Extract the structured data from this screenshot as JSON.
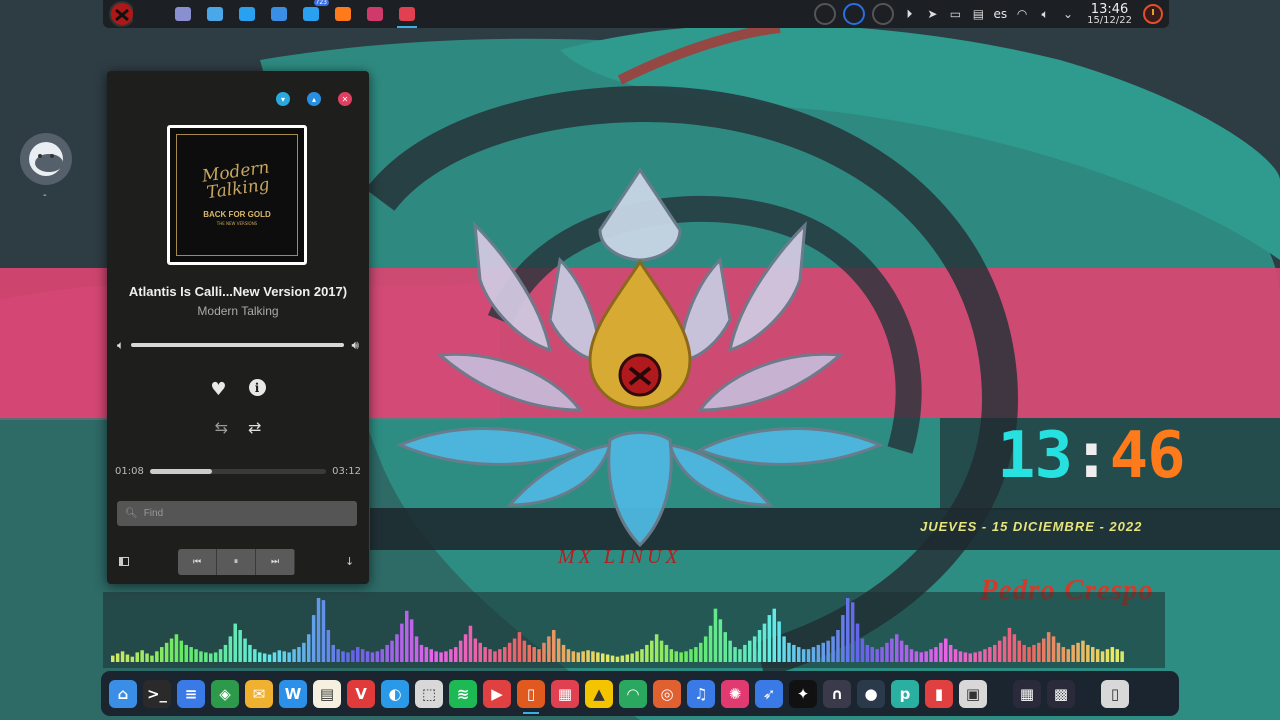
{
  "top_panel": {
    "apps": [
      {
        "icon": "desktop-pager-icon",
        "color": "#8a8fcf"
      },
      {
        "icon": "settings-sliders-icon",
        "color": "#4aa8e8"
      },
      {
        "icon": "browser-globe-icon",
        "color": "#2aa0f0"
      },
      {
        "icon": "file-manager-icon",
        "color": "#3a8ee6"
      },
      {
        "icon": "messaging-app-icon",
        "color": "#2aa0f0",
        "badge": "723"
      },
      {
        "icon": "firefox-icon",
        "color": "#ff7a1a"
      },
      {
        "icon": "screen-capture-icon",
        "color": "#d03a6a"
      },
      {
        "icon": "music-player-icon",
        "color": "#e04050",
        "active": true
      }
    ],
    "tray": {
      "keyboard_layout": "es",
      "time": "13:46",
      "date": "15/12/22"
    }
  },
  "desktop": {
    "face_widget_label": "-"
  },
  "player": {
    "album_title": "Modern Talking",
    "album_subtitle": "BACK FOR GOLD",
    "album_tagline": "THE NEW VERSIONS",
    "song_title": "Atlantis Is Calli...New Version 2017)",
    "artist": "Modern Talking",
    "volume": 1.0,
    "elapsed": "01:08",
    "duration": "03:12",
    "progress": 0.354,
    "find_placeholder": "Find"
  },
  "clock_widget": {
    "hour": "13",
    "colon": ":",
    "minute": "46",
    "date_text": "JUEVES - 15 DICIEMBRE - 2022",
    "author": "Pedro Crespo"
  },
  "wallpaper": {
    "logo_text": "MX LINUX"
  },
  "dock": {
    "items": [
      {
        "icon": "home-folder-icon",
        "color": "#3a8ee6",
        "glyph": "⌂"
      },
      {
        "icon": "terminal-icon",
        "color": "#2a2a2a",
        "glyph": ">_"
      },
      {
        "icon": "document-icon",
        "color": "#3a7ae6",
        "glyph": "≡"
      },
      {
        "icon": "layers-icon",
        "color": "#2c9a4a",
        "glyph": "◈"
      },
      {
        "icon": "mail-icon",
        "color": "#f0b030",
        "glyph": "✉"
      },
      {
        "icon": "wps-office-icon",
        "color": "#2a90e8",
        "glyph": "W"
      },
      {
        "icon": "notes-icon",
        "color": "#f5f0e0",
        "glyph": "▤"
      },
      {
        "icon": "vivaldi-icon",
        "color": "#e03a3a",
        "glyph": "V"
      },
      {
        "icon": "safari-compass-icon",
        "color": "#2a9ae8",
        "glyph": "◐"
      },
      {
        "icon": "package-installer-icon",
        "color": "#d8d8d8",
        "glyph": "⬚"
      },
      {
        "icon": "spotify-icon",
        "color": "#1db954",
        "glyph": "≋"
      },
      {
        "icon": "video-player-icon",
        "color": "#e04040",
        "glyph": "▶"
      },
      {
        "icon": "phone-app-icon",
        "color": "#e05a20",
        "glyph": "▯",
        "active": true
      },
      {
        "icon": "music-player-icon",
        "color": "#e04050",
        "glyph": "▦"
      },
      {
        "icon": "vlc-cone-icon",
        "color": "#f5c400",
        "glyph": "▲"
      },
      {
        "icon": "headphones-app-icon",
        "color": "#2aa860",
        "glyph": "◠"
      },
      {
        "icon": "vinyl-record-icon",
        "color": "#e06030",
        "glyph": "◎"
      },
      {
        "icon": "music-note-icon",
        "color": "#3a7ae6",
        "glyph": "♫"
      },
      {
        "icon": "pinwheel-icon",
        "color": "#e03a70",
        "glyph": "✺"
      },
      {
        "icon": "bird-app-icon",
        "color": "#3a7ae6",
        "glyph": "➶"
      },
      {
        "icon": "inkscape-icon",
        "color": "#111111",
        "glyph": "✦"
      },
      {
        "icon": "headset-icon",
        "color": "#3a3a4a",
        "glyph": "∩"
      },
      {
        "icon": "palette-icon",
        "color": "#2a3a4a",
        "glyph": "●"
      },
      {
        "icon": "picsart-icon",
        "color": "#2ab0a0",
        "glyph": "p"
      },
      {
        "icon": "paint-bottles-icon",
        "color": "#e04040",
        "glyph": "▮"
      },
      {
        "icon": "window-frame-icon",
        "color": "#d8d8d8",
        "glyph": "▣"
      },
      {
        "icon": "app-grid-icon",
        "color": "#2a2a3a",
        "glyph": "▦"
      },
      {
        "icon": "widget-grid-icon",
        "color": "#2a2a3a",
        "glyph": "▩"
      },
      {
        "icon": "trash-icon",
        "color": "#d8d8d8",
        "glyph": "▯"
      }
    ]
  },
  "visualizer": {
    "levels": [
      6,
      8,
      10,
      7,
      5,
      9,
      11,
      8,
      6,
      10,
      14,
      18,
      22,
      26,
      20,
      16,
      14,
      12,
      10,
      9,
      8,
      9,
      12,
      16,
      24,
      36,
      30,
      22,
      16,
      12,
      9,
      8,
      7,
      9,
      11,
      10,
      9,
      12,
      14,
      18,
      26,
      44,
      60,
      58,
      30,
      16,
      12,
      10,
      9,
      11,
      14,
      12,
      10,
      9,
      10,
      12,
      16,
      20,
      26,
      36,
      48,
      40,
      24,
      16,
      14,
      12,
      10,
      9,
      10,
      12,
      14,
      20,
      26,
      34,
      22,
      18,
      14,
      12,
      10,
      12,
      14,
      18,
      22,
      28,
      20,
      16,
      14,
      12,
      18,
      24,
      30,
      22,
      16,
      12,
      10,
      9,
      10,
      11,
      10,
      9,
      8,
      7,
      6,
      5,
      6,
      7,
      8,
      10,
      12,
      16,
      20,
      26,
      20,
      16,
      12,
      10,
      9,
      10,
      12,
      14,
      18,
      24,
      34,
      50,
      40,
      28,
      20,
      14,
      12,
      16,
      20,
      24,
      30,
      36,
      44,
      50,
      38,
      24,
      18,
      16,
      14,
      12,
      12,
      14,
      16,
      18,
      20,
      24,
      30,
      44,
      60,
      56,
      36,
      22,
      16,
      14,
      12,
      14,
      18,
      22,
      26,
      20,
      16,
      12,
      10,
      9,
      10,
      12,
      14,
      18,
      22,
      16,
      12,
      10,
      9,
      8,
      9,
      10,
      12,
      14,
      16,
      20,
      24,
      32,
      26,
      20,
      16,
      14,
      16,
      18,
      22,
      28,
      24,
      18,
      14,
      12,
      16,
      18,
      20,
      16,
      14,
      12,
      10,
      12,
      14,
      12,
      10
    ]
  }
}
